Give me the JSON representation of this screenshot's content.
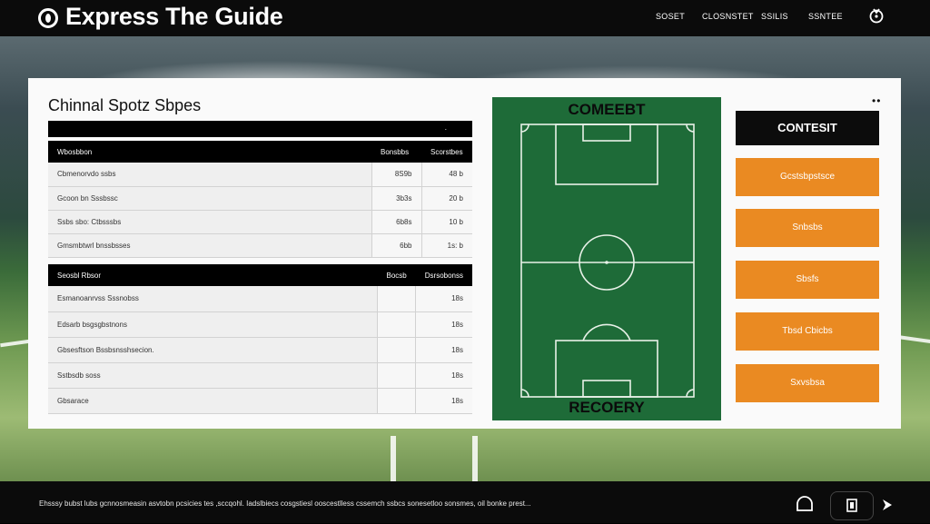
{
  "app": {
    "title": "Express The Guide"
  },
  "nav": [
    "SOSET",
    "CLOSNSTET",
    "SSILIS",
    "SSNTEE"
  ],
  "panel": {
    "title": "Chinnal Spotz Sbpes",
    "table1": {
      "bar_right": "·        ",
      "headers": [
        "Wbosbbon",
        "Bonsbbs",
        "Scorstbes"
      ],
      "rows": [
        [
          "Cbmenorvdo ssbs",
          "8S9b",
          "48 b"
        ],
        [
          "Gcoon bn Sssbssc",
          "3b3s",
          "20 b"
        ],
        [
          "Ssbs sbo: Ctbsssbs",
          "6b8s",
          "10 b"
        ],
        [
          "Gmsmbtwrl bnssbsses",
          "6bb",
          "1s: b"
        ]
      ]
    },
    "table2": {
      "headers": [
        "Seosbl Rbsor",
        "Bocsb",
        "Dsrsobonss"
      ],
      "rows": [
        [
          "Esmanoanrvss Sssnobss",
          "",
          "18s"
        ],
        [
          "Edsarb bsgsgbstnons",
          "",
          "18s"
        ],
        [
          "Gbsesftson Bssbsnsshsecion.",
          "",
          "18s"
        ],
        [
          "Sstbsdb soss",
          "",
          "18s"
        ],
        [
          "Gbsarace",
          "",
          "18s"
        ]
      ]
    }
  },
  "pitch": {
    "top_label": "COMEEBT",
    "bottom_label": "RECOERY"
  },
  "sidebar": {
    "primary": "CONTESIT",
    "buttons": [
      "Gcstsbpstsce",
      "Snbsbs",
      "Sbsfs",
      "Tbsd Cbicbs",
      "Sxvsbsa"
    ]
  },
  "footer": {
    "text": "Ehsssy bubst lubs gcnnosmeasin asvtobn pcsicies tes ,sccqohl. Iadslbiecs cosgstiesl ooscestlless cssemch ssbcs sonesetloo sonsmes, oil bonke prest..."
  },
  "colors": {
    "accent_orange": "#ea8a22",
    "pitch_green": "#1e6b38",
    "bar_black": "#0b0b0b"
  },
  "icons": [
    "logo-icon",
    "user-icon",
    "more-icon",
    "bell-icon",
    "copy-icon",
    "next-icon"
  ]
}
